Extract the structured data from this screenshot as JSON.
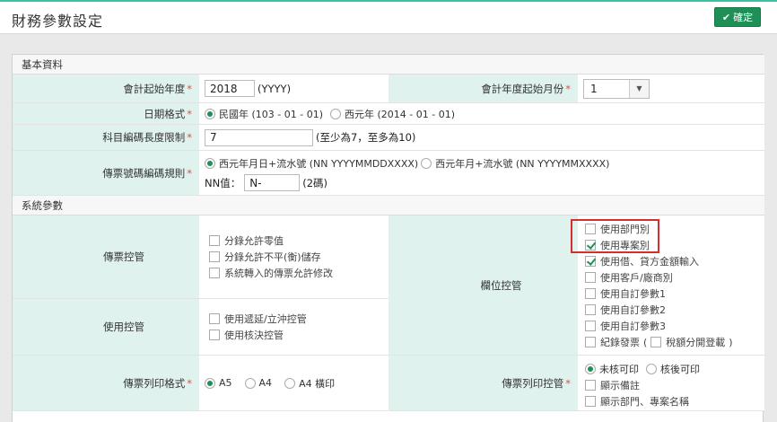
{
  "header": {
    "title": "財務參數設定",
    "confirm_label": "確定"
  },
  "basic": {
    "section_title": "基本資料",
    "fiscal_start_year": {
      "label": "會計起始年度",
      "value": "2018",
      "suffix": "(YYYY)"
    },
    "fiscal_start_month": {
      "label": "會計年度起始月份",
      "value": "1"
    },
    "date_format": {
      "label": "日期格式",
      "options": [
        "民國年 (103 - 01 - 01)",
        "西元年 (2014 - 01 - 01)"
      ],
      "selected": 0
    },
    "code_length": {
      "label": "科目編碼長度限制",
      "value": "7",
      "suffix": "(至少為7，至多為10)"
    },
    "voucher_rule": {
      "label": "傳票號碼編碼規則",
      "options": [
        "西元年月日+流水號 (NN YYYYMMDDXXXX)",
        "西元年月+流水號 (NN YYYYMMXXXX)"
      ],
      "selected": 0,
      "nn_label": "NN值：",
      "nn_value": "N-",
      "nn_suffix": "(2碼)"
    }
  },
  "system": {
    "section_title": "系統參數",
    "voucher_control": {
      "label": "傳票控管",
      "items": [
        {
          "text": "分錄允許零值",
          "checked": false
        },
        {
          "text": "分錄允許不平(衡)儲存",
          "checked": false
        },
        {
          "text": "系統轉入的傳票允許修改",
          "checked": false
        }
      ]
    },
    "usage_control": {
      "label": "使用控管",
      "items": [
        {
          "text": "使用遞延/立沖控管",
          "checked": false
        },
        {
          "text": "使用核決控管",
          "checked": false
        }
      ]
    },
    "field_control": {
      "label": "欄位控管",
      "items": [
        {
          "text": "使用部門別",
          "checked": false
        },
        {
          "text": "使用專案別",
          "checked": true
        },
        {
          "text": "使用借、貸方金額輸入",
          "checked": true
        },
        {
          "text": "使用客戶/廠商別",
          "checked": false
        },
        {
          "text": "使用自訂參數1",
          "checked": false
        },
        {
          "text": "使用自訂參數2",
          "checked": false
        },
        {
          "text": "使用自訂參數3",
          "checked": false
        }
      ],
      "record_invoice": "紀錄發票",
      "tax_split": "稅額分開登載",
      "paren_open": "(",
      "paren_close": ")"
    },
    "print_format": {
      "label": "傳票列印格式",
      "options": [
        "A5",
        "A4",
        "A4 橫印"
      ],
      "selected": 0
    },
    "print_control": {
      "label": "傳票列印控管",
      "options": [
        "未核可印",
        "核後可印"
      ],
      "selected": 0,
      "items": [
        {
          "text": "顯示備註",
          "checked": false
        },
        {
          "text": "顯示部門、專案名稱",
          "checked": false
        }
      ]
    }
  }
}
